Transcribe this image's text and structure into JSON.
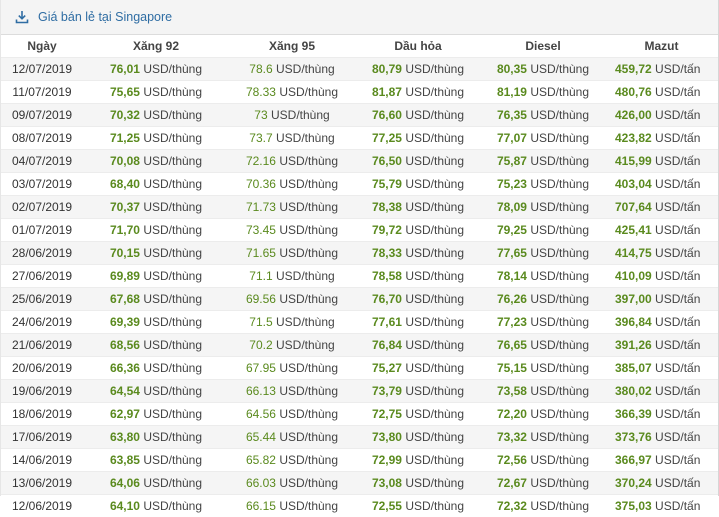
{
  "header": {
    "title": "Giá bán lẻ tại Singapore",
    "icon": "download-icon"
  },
  "colors": {
    "accent": "#2f6da3",
    "value_green": "#5a8a1e",
    "row_stripe": "#f5f5f5"
  },
  "columns": [
    "Ngày",
    "Xăng 92",
    "Xăng 95",
    "Dầu hỏa",
    "Diesel",
    "Mazut"
  ],
  "rows": [
    {
      "date": "12/07/2019",
      "x92": "76,01",
      "x92u": "USD/thùng",
      "x95": "78.6",
      "x95u": "USD/thùng",
      "dh": "80,79",
      "dhu": "USD/thùng",
      "ds": "80,35",
      "dsu": "USD/thùng",
      "mz": "459,72",
      "mzu": "USD/tấn"
    },
    {
      "date": "11/07/2019",
      "x92": "75,65",
      "x92u": "USD/thùng",
      "x95": "78.33",
      "x95u": "USD/thùng",
      "dh": "81,87",
      "dhu": "USD/thùng",
      "ds": "81,19",
      "dsu": "USD/thùng",
      "mz": "480,76",
      "mzu": "USD/tấn"
    },
    {
      "date": "09/07/2019",
      "x92": "70,32",
      "x92u": "USD/thùng",
      "x95": "73",
      "x95u": "USD/thùng",
      "dh": "76,60",
      "dhu": "USD/thùng",
      "ds": "76,35",
      "dsu": "USD/thùng",
      "mz": "426,00",
      "mzu": "USD/tấn"
    },
    {
      "date": "08/07/2019",
      "x92": "71,25",
      "x92u": "USD/thùng",
      "x95": "73.7",
      "x95u": "USD/thùng",
      "dh": "77,25",
      "dhu": "USD/thùng",
      "ds": "77,07",
      "dsu": "USD/thùng",
      "mz": "423,82",
      "mzu": "USD/tấn"
    },
    {
      "date": "04/07/2019",
      "x92": "70,08",
      "x92u": "USD/thùng",
      "x95": "72.16",
      "x95u": "USD/thùng",
      "dh": "76,50",
      "dhu": "USD/thùng",
      "ds": "75,87",
      "dsu": "USD/thùng",
      "mz": "415,99",
      "mzu": "USD/tấn"
    },
    {
      "date": "03/07/2019",
      "x92": "68,40",
      "x92u": "USD/thùng",
      "x95": "70.36",
      "x95u": "USD/thùng",
      "dh": "75,79",
      "dhu": "USD/thùng",
      "ds": "75,23",
      "dsu": "USD/thùng",
      "mz": "403,04",
      "mzu": "USD/tấn"
    },
    {
      "date": "02/07/2019",
      "x92": "70,37",
      "x92u": "USD/thùng",
      "x95": "71.73",
      "x95u": "USD/thùng",
      "dh": "78,38",
      "dhu": "USD/thùng",
      "ds": "78,09",
      "dsu": "USD/thùng",
      "mz": "707,64",
      "mzu": "USD/tấn"
    },
    {
      "date": "01/07/2019",
      "x92": "71,70",
      "x92u": "USD/thùng",
      "x95": "73.45",
      "x95u": "USD/thùng",
      "dh": "79,72",
      "dhu": "USD/thùng",
      "ds": "79,25",
      "dsu": "USD/thùng",
      "mz": "425,41",
      "mzu": "USD/tấn"
    },
    {
      "date": "28/06/2019",
      "x92": "70,15",
      "x92u": "USD/thùng",
      "x95": "71.65",
      "x95u": "USD/thùng",
      "dh": "78,33",
      "dhu": "USD/thùng",
      "ds": "77,65",
      "dsu": "USD/thùng",
      "mz": "414,75",
      "mzu": "USD/tấn"
    },
    {
      "date": "27/06/2019",
      "x92": "69,89",
      "x92u": "USD/thùng",
      "x95": "71.1",
      "x95u": "USD/thùng",
      "dh": "78,58",
      "dhu": "USD/thùng",
      "ds": "78,14",
      "dsu": "USD/thùng",
      "mz": "410,09",
      "mzu": "USD/tấn"
    },
    {
      "date": "25/06/2019",
      "x92": "67,68",
      "x92u": "USD/thùng",
      "x95": "69.56",
      "x95u": "USD/thùng",
      "dh": "76,70",
      "dhu": "USD/thùng",
      "ds": "76,26",
      "dsu": "USD/thùng",
      "mz": "397,00",
      "mzu": "USD/tấn"
    },
    {
      "date": "24/06/2019",
      "x92": "69,39",
      "x92u": "USD/thùng",
      "x95": "71.5",
      "x95u": "USD/thùng",
      "dh": "77,61",
      "dhu": "USD/thùng",
      "ds": "77,23",
      "dsu": "USD/thùng",
      "mz": "396,84",
      "mzu": "USD/tấn"
    },
    {
      "date": "21/06/2019",
      "x92": "68,56",
      "x92u": "USD/thùng",
      "x95": "70.2",
      "x95u": "USD/thùng",
      "dh": "76,84",
      "dhu": "USD/thùng",
      "ds": "76,65",
      "dsu": "USD/thùng",
      "mz": "391,26",
      "mzu": "USD/tấn"
    },
    {
      "date": "20/06/2019",
      "x92": "66,36",
      "x92u": "USD/thùng",
      "x95": "67.95",
      "x95u": "USD/thùng",
      "dh": "75,27",
      "dhu": "USD/thùng",
      "ds": "75,15",
      "dsu": "USD/thùng",
      "mz": "385,07",
      "mzu": "USD/tấn"
    },
    {
      "date": "19/06/2019",
      "x92": "64,54",
      "x92u": "USD/thùng",
      "x95": "66.13",
      "x95u": "USD/thùng",
      "dh": "73,79",
      "dhu": "USD/thùng",
      "ds": "73,58",
      "dsu": "USD/thùng",
      "mz": "380,02",
      "mzu": "USD/tấn"
    },
    {
      "date": "18/06/2019",
      "x92": "62,97",
      "x92u": "USD/thùng",
      "x95": "64.56",
      "x95u": "USD/thùng",
      "dh": "72,75",
      "dhu": "USD/thùng",
      "ds": "72,20",
      "dsu": "USD/thùng",
      "mz": "366,39",
      "mzu": "USD/tấn"
    },
    {
      "date": "17/06/2019",
      "x92": "63,80",
      "x92u": "USD/thùng",
      "x95": "65.44",
      "x95u": "USD/thùng",
      "dh": "73,80",
      "dhu": "USD/thùng",
      "ds": "73,32",
      "dsu": "USD/thùng",
      "mz": "373,76",
      "mzu": "USD/tấn"
    },
    {
      "date": "14/06/2019",
      "x92": "63,85",
      "x92u": "USD/thùng",
      "x95": "65.82",
      "x95u": "USD/thùng",
      "dh": "72,99",
      "dhu": "USD/thùng",
      "ds": "72,56",
      "dsu": "USD/thùng",
      "mz": "366,97",
      "mzu": "USD/tấn"
    },
    {
      "date": "13/06/2019",
      "x92": "64,06",
      "x92u": "USD/thùng",
      "x95": "66.03",
      "x95u": "USD/thùng",
      "dh": "73,08",
      "dhu": "USD/thùng",
      "ds": "72,67",
      "dsu": "USD/thùng",
      "mz": "370,24",
      "mzu": "USD/tấn"
    },
    {
      "date": "12/06/2019",
      "x92": "64,10",
      "x92u": "USD/thùng",
      "x95": "66.15",
      "x95u": "USD/thùng",
      "dh": "72,55",
      "dhu": "USD/thùng",
      "ds": "72,32",
      "dsu": "USD/thùng",
      "mz": "375,03",
      "mzu": "USD/tấn"
    }
  ]
}
